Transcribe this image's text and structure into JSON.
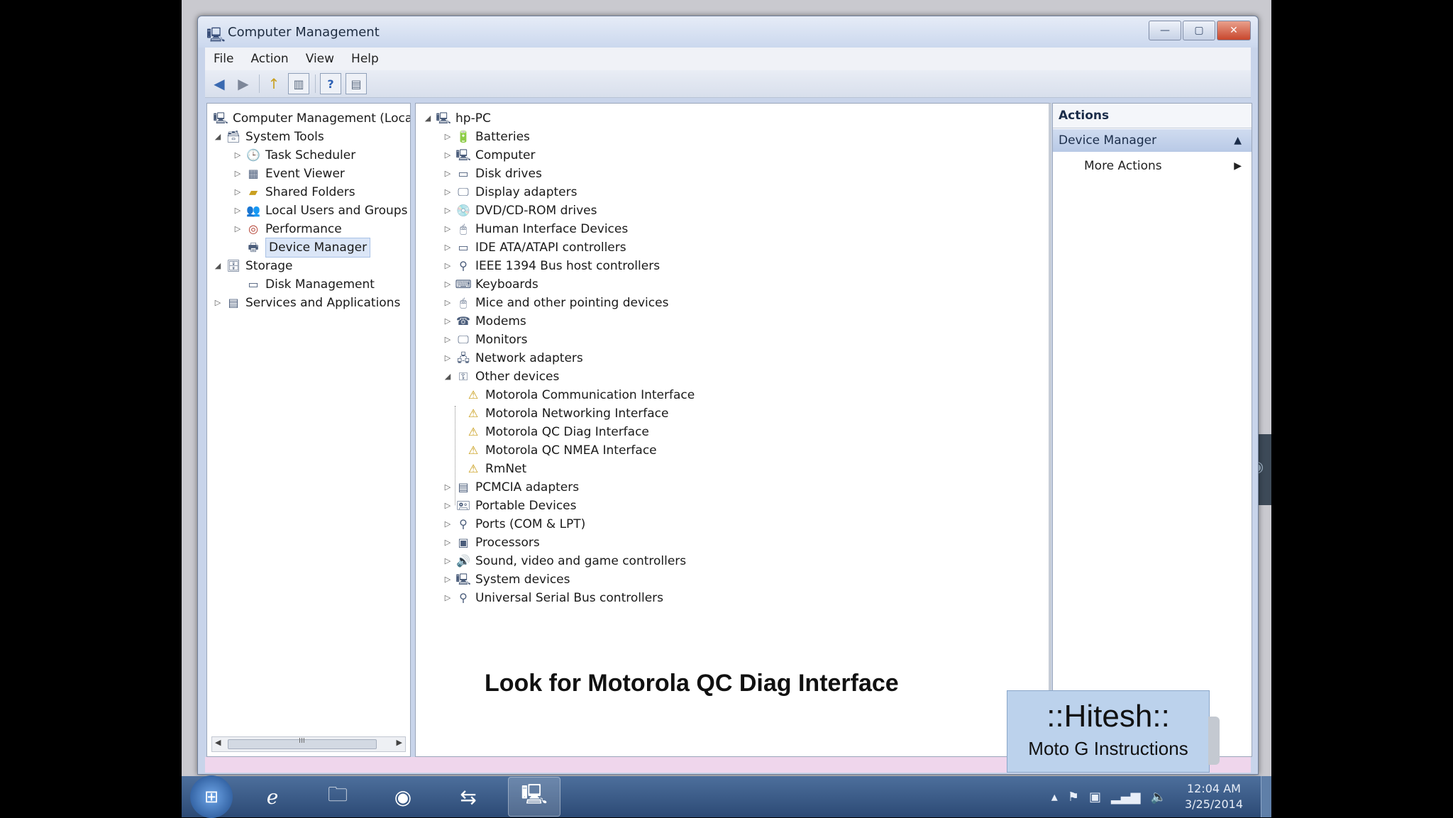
{
  "window": {
    "title": "Computer Management",
    "controls": {
      "minimize": "—",
      "restore": "▢",
      "close": "✕"
    }
  },
  "menu": [
    "File",
    "Action",
    "View",
    "Help"
  ],
  "toolbar": {
    "back": "◀",
    "forward": "▶",
    "up": "↑",
    "show_tree": "▥",
    "help": "?",
    "show_action": "▤"
  },
  "left_tree": {
    "root": "Computer Management (Local",
    "system_tools": "System Tools",
    "system_children": [
      "Task Scheduler",
      "Event Viewer",
      "Shared Folders",
      "Local Users and Groups",
      "Performance",
      "Device Manager"
    ],
    "storage": "Storage",
    "storage_children": [
      "Disk Management"
    ],
    "services": "Services and Applications",
    "scroll_grip": "III"
  },
  "device_tree": {
    "root": "hp-PC",
    "categories_before": [
      "Batteries",
      "Computer",
      "Disk drives",
      "Display adapters",
      "DVD/CD-ROM drives",
      "Human Interface Devices",
      "IDE ATA/ATAPI controllers",
      "IEEE 1394 Bus host controllers",
      "Keyboards",
      "Mice and other pointing devices",
      "Modems",
      "Monitors",
      "Network adapters"
    ],
    "other_devices": "Other devices",
    "other_children": [
      "Motorola Communication Interface",
      "Motorola Networking Interface",
      "Motorola QC Diag Interface",
      "Motorola QC NMEA Interface",
      "RmNet"
    ],
    "categories_after": [
      "PCMCIA adapters",
      "Portable Devices",
      "Ports (COM & LPT)",
      "Processors",
      "Sound, video and game controllers",
      "System devices",
      "Universal Serial Bus controllers"
    ]
  },
  "actions": {
    "header": "Actions",
    "section": "Device Manager",
    "more": "More Actions"
  },
  "caption": "Look for Motorola QC Diag Interface",
  "watermark": {
    "title": "::Hitesh::",
    "subtitle": "Moto G Instructions"
  },
  "taskbar": {
    "clock_time": "12:04 AM",
    "clock_date": "3/25/2014"
  },
  "colors": {
    "selection": "#dbe6f7",
    "statusbar": "#efd6ec",
    "actions_section": "#c5d4ec"
  }
}
